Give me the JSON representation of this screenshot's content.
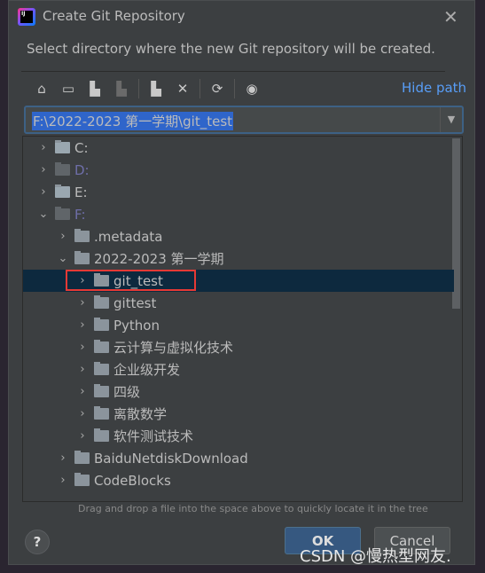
{
  "dialog": {
    "title": "Create Git Repository",
    "description": "Select directory where the new Git repository will be created.",
    "close_icon": "close-icon"
  },
  "toolbar": {
    "icons": [
      "home-icon",
      "desktop-icon",
      "project-folder-icon",
      "module-folder-icon",
      "new-folder-icon",
      "delete-icon",
      "refresh-icon",
      "show-hidden-icon"
    ],
    "hide_path": "Hide path"
  },
  "path": {
    "value": "F:\\2022-2023 第一学期\\git_test"
  },
  "tree": {
    "rows": [
      {
        "label": "C:",
        "level": 0,
        "expanded": false,
        "drive": true,
        "dim": false
      },
      {
        "label": "D:",
        "level": 0,
        "expanded": false,
        "drive": true,
        "dim": true
      },
      {
        "label": "E:",
        "level": 0,
        "expanded": false,
        "drive": true,
        "dim": false
      },
      {
        "label": "F:",
        "level": 0,
        "expanded": true,
        "drive": true,
        "dim": true
      },
      {
        "label": ".metadata",
        "level": 1,
        "expanded": false
      },
      {
        "label": "2022-2023 第一学期",
        "level": 1,
        "expanded": true
      },
      {
        "label": "git_test",
        "level": 2,
        "expanded": false,
        "selected": true
      },
      {
        "label": "gittest",
        "level": 2,
        "expanded": false
      },
      {
        "label": "Python",
        "level": 2,
        "expanded": false
      },
      {
        "label": "云计算与虚拟化技术",
        "level": 2,
        "expanded": false
      },
      {
        "label": "企业级开发",
        "level": 2,
        "expanded": false
      },
      {
        "label": "四级",
        "level": 2,
        "expanded": false
      },
      {
        "label": "离散数学",
        "level": 2,
        "expanded": false
      },
      {
        "label": "软件测试技术",
        "level": 2,
        "expanded": false
      },
      {
        "label": "BaiduNetdiskDownload",
        "level": 1,
        "expanded": false
      },
      {
        "label": "CodeBlocks",
        "level": 1,
        "expanded": false
      }
    ]
  },
  "hint": "Drag and drop a file into the space above to quickly locate it in the tree",
  "buttons": {
    "help": "?",
    "ok": "OK",
    "cancel": "Cancel"
  },
  "watermark": "CSDN @慢热型网友.",
  "colors": {
    "selection": "#0d293e",
    "highlight_box": "#e53935",
    "link": "#589df6",
    "ok_button": "#365880"
  }
}
